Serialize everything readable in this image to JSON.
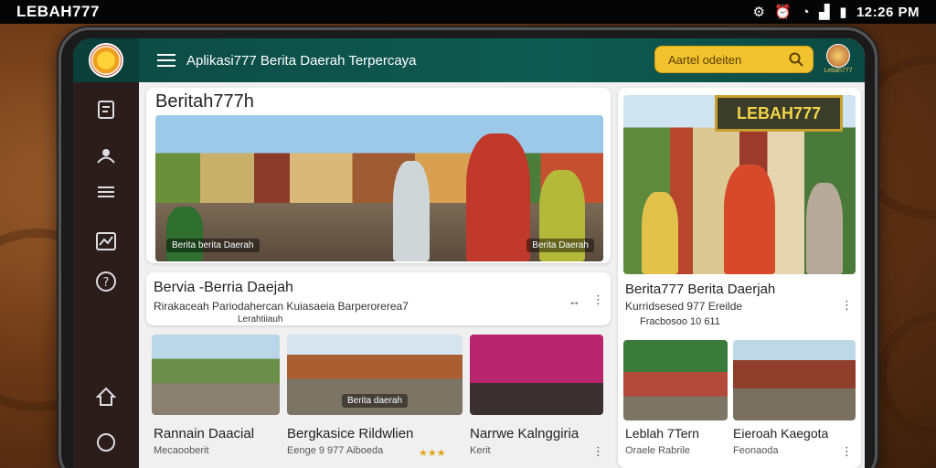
{
  "status_bar": {
    "carrier": "LEBAH777",
    "time": "12:26 PM"
  },
  "header": {
    "title": "Aplikasi777 Berita Daerah Terpercaya",
    "search_placeholder": "Aartel odeiten",
    "avatar_label": "Lebah777"
  },
  "sidebar": {
    "icons": [
      "document-icon",
      "user-icon",
      "list-icon",
      "chart-icon",
      "help-icon",
      "home-icon",
      "circle-icon"
    ]
  },
  "main": {
    "title": "Beritah777h",
    "hero_caption_left": "Berita berita Daerah",
    "hero_caption_right": "Berita Daerah",
    "section_title": "Bervia -Berria Daejah",
    "section_sub_1": "Rirakaceah  Pariodahercan Kuiasaeia Barperorerea7",
    "section_sub_2": "Lerahtiiauh",
    "more": "⋮",
    "thumbs": [
      {
        "title": "Rannain Daacial",
        "sub": "Mecaooberit"
      },
      {
        "title": "Bergkasice Rildwlien",
        "sub": "Eenge 9 977 Aiboeda"
      },
      {
        "title": "Narrwe Kalnggiria",
        "sub": "Kerit"
      }
    ],
    "thumb_caption": "Berita daerah"
  },
  "right": {
    "banner": "LEBAH777",
    "section_title": "Berita777 Berita Daerjah",
    "sub_1": "Kurridsesed 977 Ereilde",
    "sub_2": "Fracbosoo 10 611",
    "thumbs": [
      {
        "title": "Leblah 7Tern",
        "sub": "Oraele Rabrile"
      },
      {
        "title": "Eieroah Kaegota",
        "sub": "Feonaoda"
      }
    ]
  },
  "colors": {
    "header": "#0f5b52",
    "sidebar": "#2c1d1d",
    "search": "#f2c12e",
    "accent_green": "#2e9a3a"
  }
}
